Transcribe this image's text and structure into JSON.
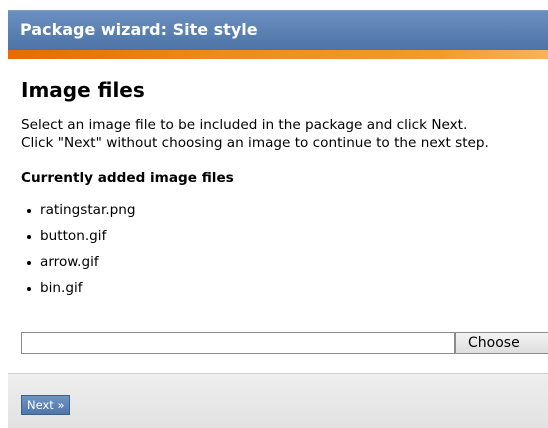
{
  "header": {
    "title": "Package wizard: Site style"
  },
  "main": {
    "heading": "Image files",
    "description_lines": [
      "Select an image file to be included in the package and click Next.",
      "Click \"Next\" without choosing an image to continue to the next step."
    ],
    "list_heading": "Currently added image files",
    "files": [
      "ratingstar.png",
      "button.gif",
      "arrow.gif",
      "bin.gif"
    ],
    "file_input": {
      "value": ""
    },
    "choose_label": "Choose"
  },
  "footer": {
    "next_label": "Next »"
  },
  "colors": {
    "titlebar": "#5a7fb2",
    "accent": "#ee8012",
    "next_button": "#5b82b7"
  }
}
